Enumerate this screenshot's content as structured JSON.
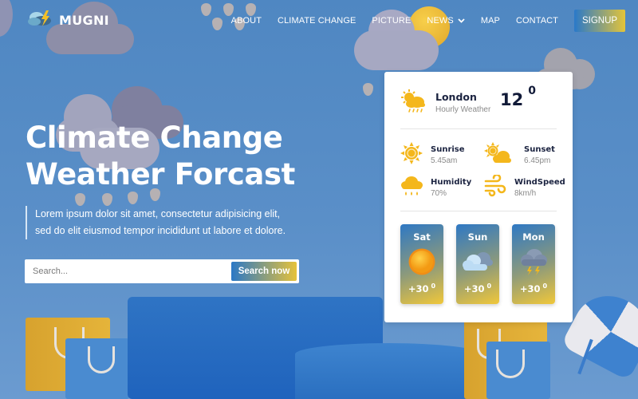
{
  "brand": {
    "name": "MUGNI",
    "icon": "storm-cloud-logo-icon"
  },
  "nav": {
    "items": [
      {
        "label": "ABOUT"
      },
      {
        "label": "CLIMATE CHANGE"
      },
      {
        "label": "PICTURE"
      },
      {
        "label": "NEWS",
        "icon": "chevron-down-icon"
      },
      {
        "label": "MAP"
      },
      {
        "label": "CONTACT"
      }
    ],
    "signup_label": "SIGNUP"
  },
  "hero": {
    "title_line1": "Climate Change",
    "title_line2": "Weather Forcast",
    "description": "Lorem ipsum dolor sit amet, consectetur adipisicing elit, sed do elit eiusmod tempor incididunt ut labore et dolore.",
    "search": {
      "placeholder": "Search...",
      "value": "",
      "button_label": "Search now"
    }
  },
  "weather_card": {
    "city": "London",
    "subtitle": "Hourly Weather",
    "temperature": "12",
    "degree_symbol": "0",
    "icon": "sun-cloud-rain-icon",
    "stats": [
      {
        "label": "Sunrise",
        "value": "5.45am",
        "icon": "sun-icon"
      },
      {
        "label": "Sunset",
        "value": "6.45pm",
        "icon": "sun-behind-cloud-icon"
      },
      {
        "label": "Humidity",
        "value": "70%",
        "icon": "rain-cloud-icon"
      },
      {
        "label": "WindSpeed",
        "value": "8km/h",
        "icon": "wind-icon"
      }
    ],
    "forecast": [
      {
        "day": "Sat",
        "temp": "+30",
        "degree": "0",
        "icon": "sunny-icon"
      },
      {
        "day": "Sun",
        "temp": "+30",
        "degree": "0",
        "icon": "cloudy-icon"
      },
      {
        "day": "Mon",
        "temp": "+30",
        "degree": "0",
        "icon": "thunderstorm-icon"
      }
    ]
  },
  "colors": {
    "background": "#5088c3",
    "accent_blue": "#2b78c6",
    "accent_yellow": "#e6c23a",
    "icon_yellow": "#f4b71c",
    "text_dark": "#1b2340"
  }
}
